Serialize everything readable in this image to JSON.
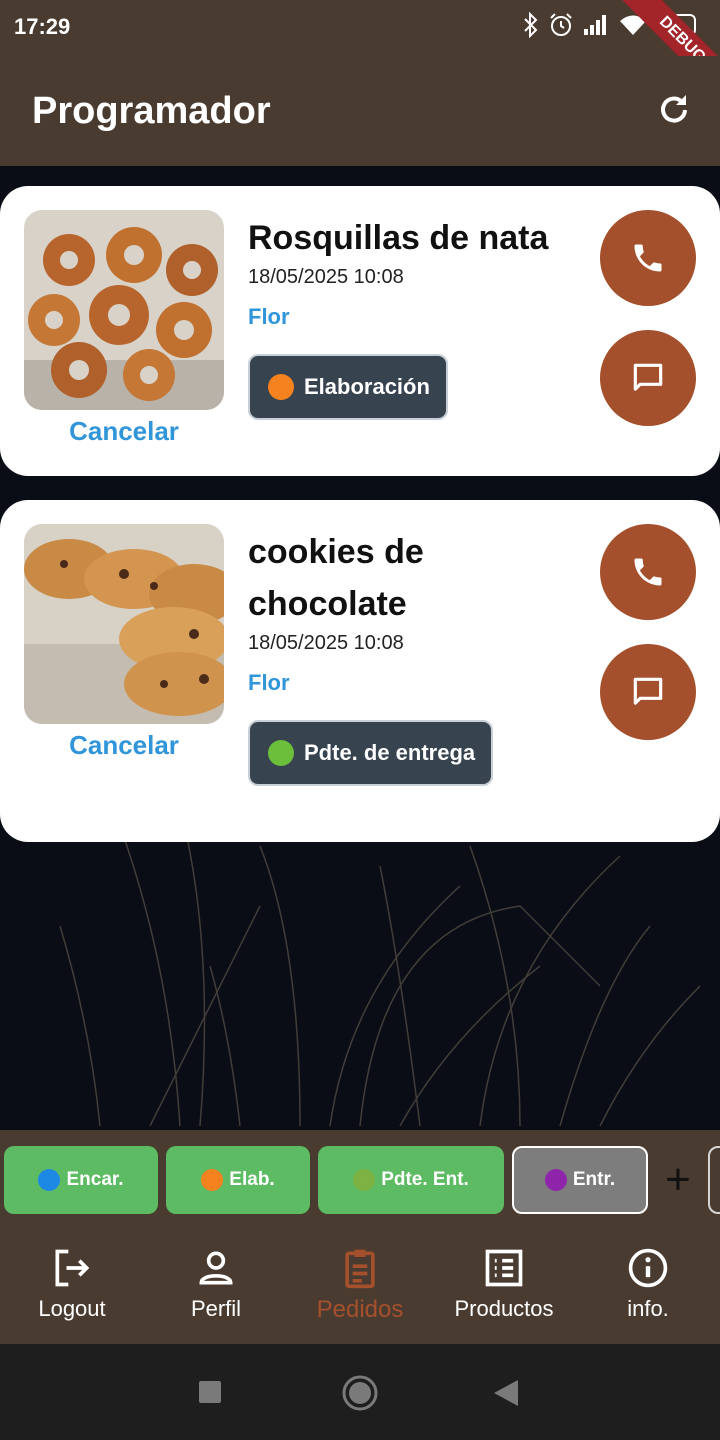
{
  "status_bar": {
    "time": "17:29",
    "battery": "42",
    "debug_label": "DEBUG"
  },
  "app_bar": {
    "title": "Programador"
  },
  "orders": [
    {
      "title": "Rosquillas de nata",
      "date": "18/05/2025 10:08",
      "customer": "Flor",
      "status": "Elaboración",
      "status_color": "#f5821f",
      "cancel": "Cancelar"
    },
    {
      "title": "cookies de chocolate",
      "date": "18/05/2025 10:08",
      "customer": "Flor",
      "status": "Pdte. de entrega",
      "status_color": "#6cbf3a",
      "cancel": "Cancelar"
    }
  ],
  "filters": [
    {
      "label": "Encar.",
      "dot_color": "#1e88e5",
      "selected": false
    },
    {
      "label": "Elab.",
      "dot_color": "#f5821f",
      "selected": false
    },
    {
      "label": "Pdte. Ent.",
      "dot_color": "#7cb342",
      "selected": false
    },
    {
      "label": "Entr.",
      "dot_color": "#8e24aa",
      "selected": true
    }
  ],
  "add_filter": "+",
  "nav": [
    {
      "label": "Logout",
      "icon": "logout-icon"
    },
    {
      "label": "Perfil",
      "icon": "person-icon"
    },
    {
      "label": "Pedidos",
      "icon": "clipboard-icon",
      "active": true
    },
    {
      "label": "Productos",
      "icon": "list-icon"
    },
    {
      "label": "info.",
      "icon": "info-icon"
    }
  ],
  "colors": {
    "header_brown": "#4a3b31",
    "accent_rust": "#a4502c",
    "link_blue": "#3195d9",
    "chip_green": "#5dbb63",
    "pill_slate": "#37434f"
  }
}
